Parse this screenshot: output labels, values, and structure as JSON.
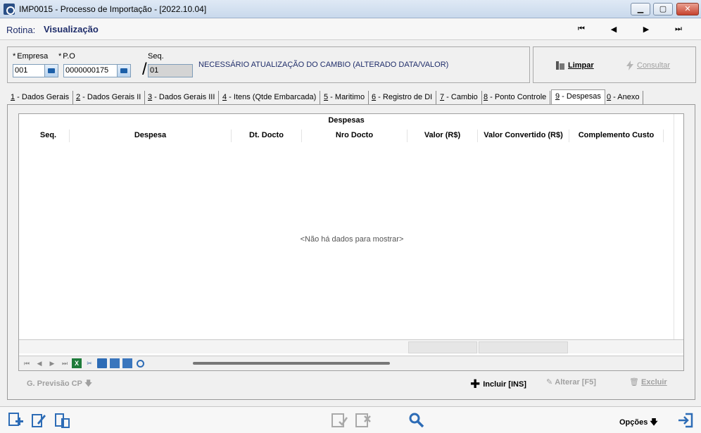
{
  "window": {
    "title": "IMP0015 - Processo de Importação - [2022.10.04]",
    "min": "▁",
    "max": "▢",
    "close": "✕"
  },
  "rotina": {
    "label": "Rotina:",
    "value": "Visualização",
    "nav": {
      "first": "⏮",
      "prev": "◀",
      "next": "▶",
      "last": "⏭"
    }
  },
  "filters": {
    "empresa_label": "Empresa",
    "empresa_value": "001",
    "po_label": "P.O",
    "po_value": "0000000175",
    "seq_label": "Seq.",
    "seq_value": "01",
    "required_mark": "*",
    "slash": "/",
    "message": "NECESSÁRIO ATUALIZAÇÃO DO CAMBIO (ALTERADO DATA/VALOR)"
  },
  "actions": {
    "limpar": "Limpar",
    "consultar": "Consultar"
  },
  "tabs": [
    {
      "key": "1",
      "label": " - Dados Gerais"
    },
    {
      "key": "2",
      "label": " - Dados Gerais II"
    },
    {
      "key": "3",
      "label": " - Dados Gerais III"
    },
    {
      "key": "4",
      "label": " - Itens (Qtde Embarcada)"
    },
    {
      "key": "5",
      "label": " - Maritimo"
    },
    {
      "key": "6",
      "label": " - Registro de DI"
    },
    {
      "key": "7",
      "label": " - Cambio"
    },
    {
      "key": "8",
      "label": " - Ponto Controle"
    },
    {
      "key": "9",
      "label": " - Despesas"
    },
    {
      "key": "0",
      "label": " - Anexo"
    }
  ],
  "grid": {
    "title": "Despesas",
    "columns": [
      "Seq.",
      "Despesa",
      "Dt. Docto",
      "Nro Docto",
      "Valor (R$)",
      "Valor Convertido (R$)",
      "Complemento Custo"
    ],
    "empty_message": "<Não há dados para mostrar>",
    "toolbar": {
      "first": "⏮",
      "prev": "◀",
      "next": "▶",
      "last": "⏭",
      "excel": "X"
    }
  },
  "lower_actions": {
    "previsao": "G. Previsão CP",
    "incluir": "Incluir [INS]",
    "alterar": "Alterar [F5]",
    "excluir": "Excluir"
  },
  "bottom": {
    "opcoes": "Opções"
  }
}
